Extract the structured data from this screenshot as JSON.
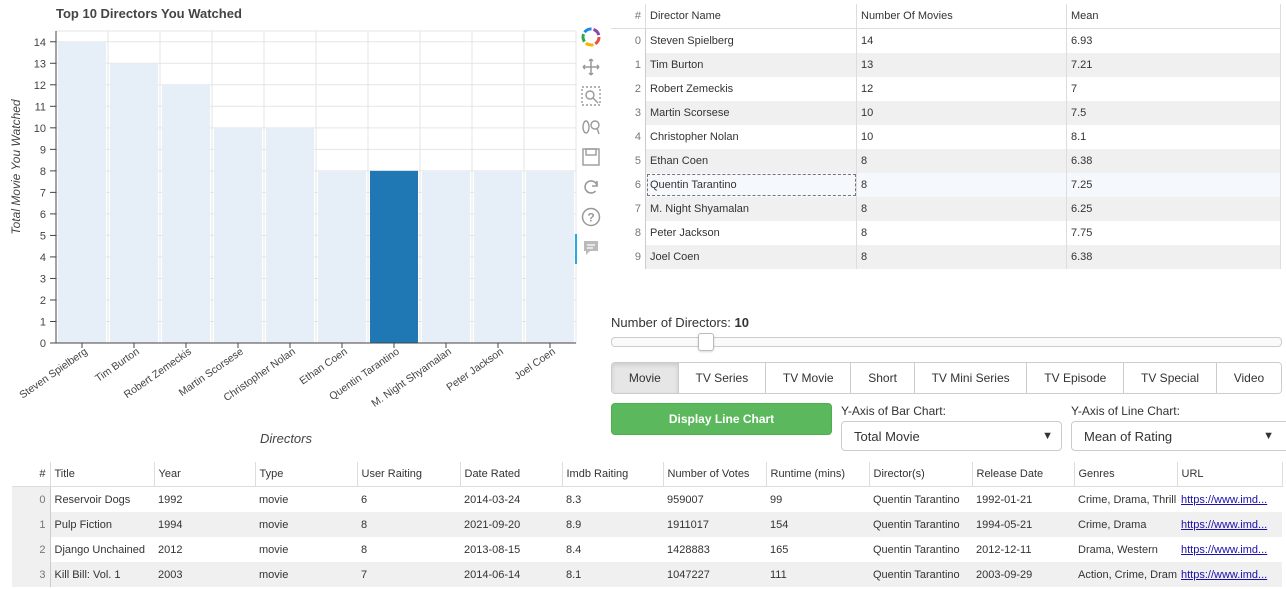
{
  "chart_data": {
    "type": "bar",
    "title": "Top 10 Directors You Watched",
    "xlabel": "Directors",
    "ylabel": "Total Movie You Watched",
    "categories": [
      "Steven Spielberg",
      "Tim Burton",
      "Robert Zemeckis",
      "Martin Scorsese",
      "Christopher Nolan",
      "Ethan Coen",
      "Quentin Tarantino",
      "M. Night Shyamalan",
      "Peter Jackson",
      "Joel Coen"
    ],
    "values": [
      14,
      13,
      12,
      10,
      10,
      8,
      8,
      8,
      8,
      8
    ],
    "highlighted": "Quentin Tarantino",
    "ylim": [
      0,
      14.5
    ],
    "yticks": [
      "0",
      "1",
      "2",
      "3",
      "4",
      "5",
      "6",
      "7",
      "8",
      "9",
      "10",
      "11",
      "12",
      "13",
      "14"
    ],
    "grid": true,
    "colors": {
      "bar": "#e6eef7",
      "highlight": "#1f77b4"
    }
  },
  "toolbar": [
    "bokeh-logo-icon",
    "pan-icon",
    "box-zoom-icon",
    "wheel-zoom-icon",
    "save-icon",
    "reset-icon",
    "help-icon",
    "hover-icon"
  ],
  "director_table": {
    "columns": [
      "#",
      "Director Name",
      "Number Of Movies",
      "Mean"
    ],
    "rows": [
      [
        "0",
        "Steven Spielberg",
        "14",
        "6.93"
      ],
      [
        "1",
        "Tim Burton",
        "13",
        "7.21"
      ],
      [
        "2",
        "Robert Zemeckis",
        "12",
        "7"
      ],
      [
        "3",
        "Martin Scorsese",
        "10",
        "7.5"
      ],
      [
        "4",
        "Christopher Nolan",
        "10",
        "8.1"
      ],
      [
        "5",
        "Ethan Coen",
        "8",
        "6.38"
      ],
      [
        "6",
        "Quentin Tarantino",
        "8",
        "7.25"
      ],
      [
        "7",
        "M. Night Shyamalan",
        "8",
        "6.25"
      ],
      [
        "8",
        "Peter Jackson",
        "8",
        "7.75"
      ],
      [
        "9",
        "Joel Coen",
        "8",
        "6.38"
      ]
    ],
    "selected_row": 6
  },
  "slider": {
    "label": "Number of Directors: ",
    "value": "10",
    "fraction": 0.14
  },
  "tabs": {
    "items": [
      "Movie",
      "TV Series",
      "TV Movie",
      "Short",
      "TV Mini Series",
      "TV Episode",
      "TV Special",
      "Video"
    ],
    "active": 0
  },
  "line_button": "Display Line Chart",
  "bar_y_axis": {
    "label": "Y-Axis of Bar Chart:",
    "value": "Total Movie"
  },
  "line_y_axis": {
    "label": "Y-Axis of Line Chart:",
    "value": "Mean of Rating"
  },
  "movies_table": {
    "columns": [
      "#",
      "Title",
      "Year",
      "Type",
      "User Raiting",
      "Date Rated",
      "Imdb Raiting",
      "Number of Votes",
      "Runtime (mins)",
      "Director(s)",
      "Release Date",
      "Genres",
      "URL"
    ],
    "rows": [
      [
        "0",
        "Reservoir Dogs",
        "1992",
        "movie",
        "6",
        "2014-03-24",
        "8.3",
        "959007",
        "99",
        "Quentin Tarantino",
        "1992-01-21",
        "Crime, Drama, Thrill",
        "https://www.imd..."
      ],
      [
        "1",
        "Pulp Fiction",
        "1994",
        "movie",
        "8",
        "2021-09-20",
        "8.9",
        "1911017",
        "154",
        "Quentin Tarantino",
        "1994-05-21",
        "Crime, Drama",
        "https://www.imd..."
      ],
      [
        "2",
        "Django Unchained",
        "2012",
        "movie",
        "8",
        "2013-08-15",
        "8.4",
        "1428883",
        "165",
        "Quentin Tarantino",
        "2012-12-11",
        "Drama, Western",
        "https://www.imd..."
      ],
      [
        "3",
        "Kill Bill: Vol. 1",
        "2003",
        "movie",
        "7",
        "2014-06-14",
        "8.1",
        "1047227",
        "111",
        "Quentin Tarantino",
        "2003-09-29",
        "Action, Crime, Dram",
        "https://www.imd..."
      ]
    ]
  }
}
